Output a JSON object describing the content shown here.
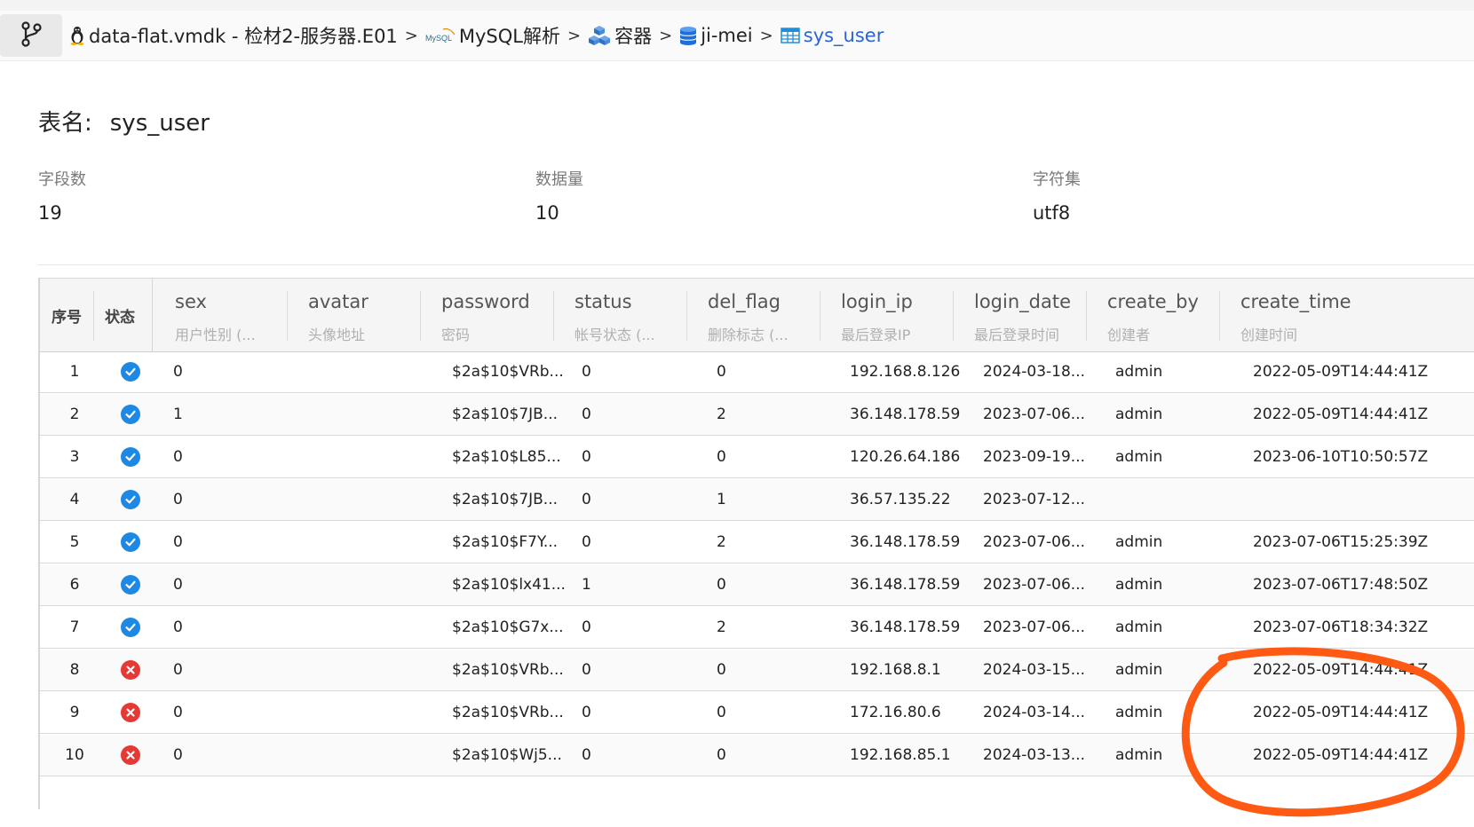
{
  "breadcrumb": {
    "items": [
      {
        "label": "data-flat.vmdk - 检材2-服务器.E01",
        "icon": "linux-tux-icon"
      },
      {
        "label": "MySQL解析",
        "icon": "mysql-logo-icon",
        "logo_text": "MySQL"
      },
      {
        "label": "容器",
        "icon": "container-cubes-icon"
      },
      {
        "label": "ji-mei",
        "icon": "database-icon"
      },
      {
        "label": "sys_user",
        "icon": "table-icon"
      }
    ],
    "separator": ">"
  },
  "summary": {
    "table_label": "表名:",
    "table_name": "sys_user",
    "fields": [
      {
        "label": "字段数",
        "value": "19"
      },
      {
        "label": "数据量",
        "value": "10"
      },
      {
        "label": "字符集",
        "value": "utf8"
      }
    ]
  },
  "table": {
    "fixed_headers": [
      "序号",
      "状态"
    ],
    "columns": [
      {
        "name": "sex",
        "comment": "用户性别 (..."
      },
      {
        "name": "avatar",
        "comment": "头像地址"
      },
      {
        "name": "password",
        "comment": "密码"
      },
      {
        "name": "status",
        "comment": "帐号状态 (..."
      },
      {
        "name": "del_flag",
        "comment": "删除标志 (..."
      },
      {
        "name": "login_ip",
        "comment": "最后登录IP"
      },
      {
        "name": "login_date",
        "comment": "最后登录时间"
      },
      {
        "name": "create_by",
        "comment": "创建者"
      },
      {
        "name": "create_time",
        "comment": "创建时间"
      }
    ],
    "rows": [
      {
        "idx": "1",
        "state": "ok",
        "cells": [
          "0",
          "",
          "$2a$10$VRb...",
          "0",
          "0",
          "192.168.8.126",
          "2024-03-18...",
          "admin",
          "2022-05-09T14:44:41Z"
        ]
      },
      {
        "idx": "2",
        "state": "ok",
        "cells": [
          "1",
          "",
          "$2a$10$7JB...",
          "0",
          "2",
          "36.148.178.59",
          "2023-07-06...",
          "admin",
          "2022-05-09T14:44:41Z"
        ]
      },
      {
        "idx": "3",
        "state": "ok",
        "cells": [
          "0",
          "",
          "$2a$10$L85...",
          "0",
          "0",
          "120.26.64.186",
          "2023-09-19...",
          "admin",
          "2023-06-10T10:50:57Z"
        ]
      },
      {
        "idx": "4",
        "state": "ok",
        "cells": [
          "0",
          "",
          "$2a$10$7JB...",
          "0",
          "1",
          "36.57.135.22",
          "2023-07-12...",
          "",
          ""
        ]
      },
      {
        "idx": "5",
        "state": "ok",
        "cells": [
          "0",
          "",
          "$2a$10$F7Y...",
          "0",
          "2",
          "36.148.178.59",
          "2023-07-06...",
          "admin",
          "2023-07-06T15:25:39Z"
        ]
      },
      {
        "idx": "6",
        "state": "ok",
        "cells": [
          "0",
          "",
          "$2a$10$lx41...",
          "1",
          "0",
          "36.148.178.59",
          "2023-07-06...",
          "admin",
          "2023-07-06T17:48:50Z"
        ]
      },
      {
        "idx": "7",
        "state": "ok",
        "cells": [
          "0",
          "",
          "$2a$10$G7x...",
          "0",
          "2",
          "36.148.178.59",
          "2023-07-06...",
          "admin",
          "2023-07-06T18:34:32Z"
        ]
      },
      {
        "idx": "8",
        "state": "error",
        "cells": [
          "0",
          "",
          "$2a$10$VRb...",
          "0",
          "0",
          "192.168.8.1",
          "2024-03-15...",
          "admin",
          "2022-05-09T14:44:41Z"
        ]
      },
      {
        "idx": "9",
        "state": "error",
        "cells": [
          "0",
          "",
          "$2a$10$VRb...",
          "0",
          "0",
          "172.16.80.6",
          "2024-03-14...",
          "admin",
          "2022-05-09T14:44:41Z"
        ]
      },
      {
        "idx": "10",
        "state": "error",
        "cells": [
          "0",
          "",
          "$2a$10$Wj5...",
          "0",
          "0",
          "192.168.85.1",
          "2024-03-13...",
          "admin",
          "2022-05-09T14:44:41Z"
        ]
      }
    ]
  },
  "annotation": {
    "color": "#ff5a14",
    "shape": "hand-drawn-circle"
  },
  "colors": {
    "ok": "#1e88e5",
    "error": "#e53935",
    "link": "#2a64d6"
  }
}
